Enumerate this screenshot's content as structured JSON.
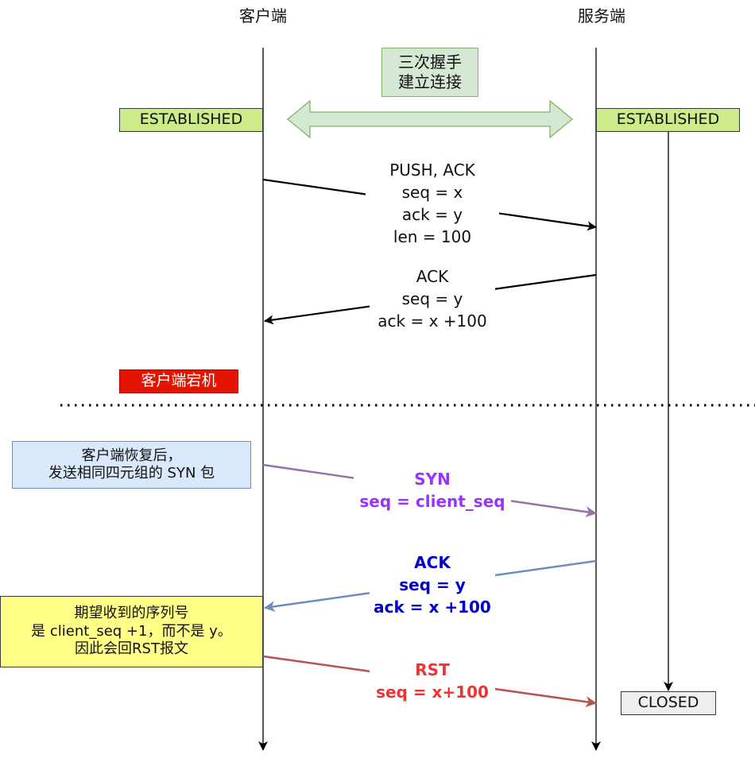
{
  "actors": {
    "client": "客户端",
    "server": "服务端"
  },
  "states": {
    "client_established": "ESTABLISHED",
    "server_established": "ESTABLISHED",
    "server_closed": "CLOSED"
  },
  "handshake_note": {
    "line1": "三次握手",
    "line2": "建立连接"
  },
  "crash_note": "客户端宕机",
  "recover_note": {
    "line1": "客户端恢复后，",
    "line2": "发送相同四元组的 SYN 包"
  },
  "expect_note": {
    "line1": "期望收到的序列号",
    "line2": "是 client_seq +1，而不是 y。",
    "line3": "因此会回RST报文"
  },
  "messages": [
    {
      "direction": "client-to-server",
      "color": "#000000",
      "lines": [
        "PUSH, ACK",
        "seq = x",
        "ack = y",
        "len = 100"
      ]
    },
    {
      "direction": "server-to-client",
      "color": "#000000",
      "lines": [
        "ACK",
        "seq = y",
        "ack = x +100"
      ]
    },
    {
      "direction": "client-to-server",
      "color": "#9933ff",
      "arrow_color": "#9673a6",
      "lines": [
        "SYN",
        "seq = client_seq"
      ]
    },
    {
      "direction": "server-to-client",
      "color": "#0000cc",
      "arrow_color": "#6c8ebf",
      "lines": [
        "ACK",
        "seq = y",
        "ack = x +100"
      ]
    },
    {
      "direction": "client-to-server",
      "color": "#ee3333",
      "arrow_color": "#b85450",
      "lines": [
        "RST",
        "seq = x+100"
      ]
    }
  ]
}
